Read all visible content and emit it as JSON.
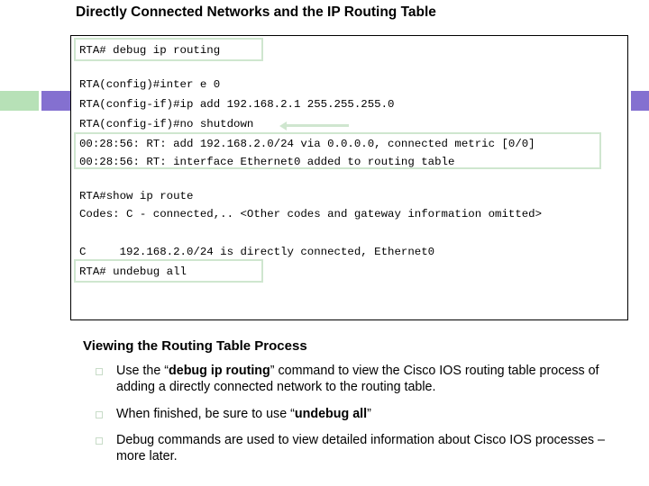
{
  "slide": {
    "title": "Directly Connected Networks and the IP Routing Table"
  },
  "colors": {
    "accent_green": "#b7e1b7",
    "accent_purple": "#8470d0",
    "highlight_border": "#cfe6cf"
  },
  "terminal": {
    "lines": [
      {
        "text": "RTA# debug ip routing"
      },
      {
        "text": ""
      },
      {
        "text": "RTA(config)#inter e 0"
      },
      {
        "text": "RTA(config-if)#ip add 192.168.2.1 255.255.255.0"
      },
      {
        "text": "RTA(config-if)#no shutdown"
      },
      {
        "text": "00:28:56: RT: add 192.168.2.0/24 via 0.0.0.0, connected metric [0/0]"
      },
      {
        "text": "00:28:56: RT: interface Ethernet0 added to routing table"
      },
      {
        "text": ""
      },
      {
        "text": "RTA#show ip route"
      },
      {
        "text": "Codes: C - connected,.. <Other codes and gateway information omitted>"
      },
      {
        "text": ""
      },
      {
        "text": "C     192.168.2.0/24 is directly connected, Ethernet0"
      },
      {
        "text": "RTA# undebug all"
      }
    ]
  },
  "section": {
    "heading": "Viewing the Routing Table Process",
    "bullets": [
      {
        "parts": [
          {
            "t": "Use the “",
            "b": false
          },
          {
            "t": "debug ip routing",
            "b": true
          },
          {
            "t": "” command to view the Cisco IOS routing table process of adding a directly connected network to the routing table.",
            "b": false
          }
        ]
      },
      {
        "parts": [
          {
            "t": "When finished, be sure to use “",
            "b": false
          },
          {
            "t": "undebug all",
            "b": true
          },
          {
            "t": "”",
            "b": false
          }
        ]
      },
      {
        "parts": [
          {
            "t": "Debug commands are used to view detailed information about Cisco IOS processes – more later.",
            "b": false
          }
        ]
      }
    ]
  }
}
